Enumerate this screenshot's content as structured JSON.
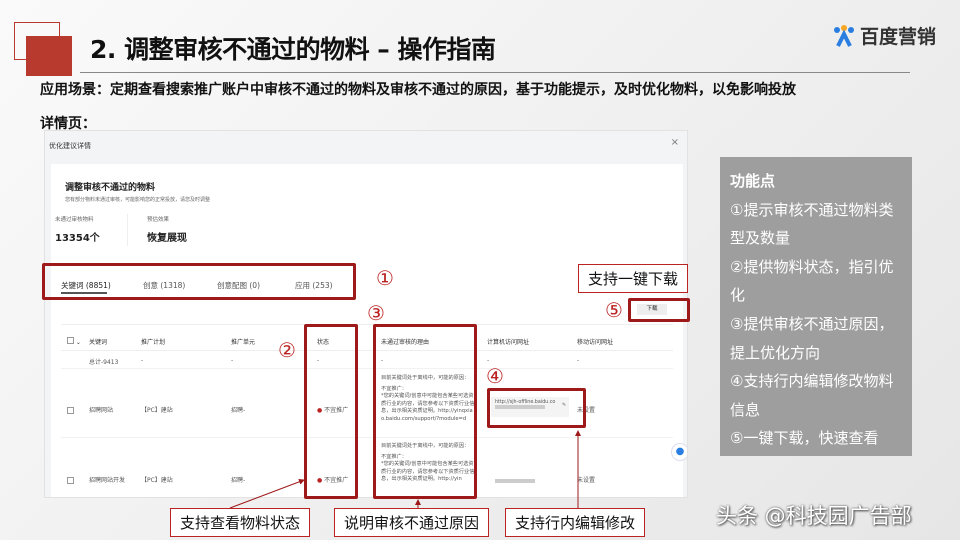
{
  "slide": {
    "title": "2. 调整审核不通过的物料 – 操作指南",
    "logo": "百度营销",
    "scenario": "应用场景：定期查看搜索推广账户中审核不通过的物料及审核不通过的原因，基于功能提示，及时优化物料，以免影响投放",
    "detail_label": "详情页：",
    "watermark": "头条 @科技园广告部"
  },
  "screenshot": {
    "header": "优化建议详情",
    "close": "×",
    "card_title": "调整审核不通过的物料",
    "card_subtitle": "您有部分物料未通过审核，可能影响您的正常投放，请您及时调整",
    "stat1_label": "未通过审核物料",
    "stat1_value": "13354个",
    "stat2_label": "预估效果",
    "stat2_value": "恢复展现",
    "tabs": [
      {
        "label": "关键词 (8851)"
      },
      {
        "label": "创意 (1318)"
      },
      {
        "label": "创意配图 (0)"
      },
      {
        "label": "应用 (253)"
      }
    ],
    "download": "下载",
    "columns": [
      "关键词",
      "推广计划",
      "推广单元",
      "状态",
      "未通过审核的理由",
      "计算机访问网址",
      "移动访问网址"
    ],
    "total_row": [
      "总计-9413",
      "-",
      "-",
      "-",
      "-",
      "-",
      "-"
    ],
    "rows": [
      {
        "keyword": "招聘网站",
        "plan": "【PC】建站",
        "unit": "招聘-",
        "status": "不宜推广",
        "reason_intro": "目前关键词处于离线中，可能的原因：",
        "reason_title": "不宜推广：",
        "reason": "*您的关键词/创意中可能包含某些可选资质行业的内容，请您参考以下资质行业信息，出示相关资质证明。http://yinqxiao.baidu.com/support/?module=d",
        "pc_url": "http://sjh-offline.baidu.co",
        "mobile_url": "未设置"
      },
      {
        "keyword": "招聘网站开发",
        "plan": "【PC】建站",
        "unit": "招聘-",
        "status": "不宜推广",
        "reason_intro": "目前关键词处于离线中，可能的原因：",
        "reason_title": "不宜推广：",
        "reason": "*您的关键词/创意中可能包含某些可选资质行业的内容，请您参考以下资质行业信息，出示相关资质证明。http://yin",
        "pc_url": "",
        "mobile_url": "未设置"
      }
    ]
  },
  "annotations": {
    "n1": "①",
    "n2": "②",
    "n3": "③",
    "n4": "④",
    "n5": "⑤",
    "download_tip": "支持一键下载",
    "callout_status": "支持查看物料状态",
    "callout_reason": "说明审核不通过原因",
    "callout_edit": "支持行内编辑修改"
  },
  "features": {
    "title": "功能点",
    "items": [
      "①提示审核不通过物料类型及数量",
      "②提供物料状态，指引优化",
      "③提供审核不通过原因，提上优化方向",
      "④支持行内编辑修改物料信息",
      "⑤一键下载，快速查看"
    ]
  },
  "colors": {
    "accent": "#b83a2e",
    "annotation_red": "#9e1a1a",
    "panel": "#9e9e9e"
  }
}
